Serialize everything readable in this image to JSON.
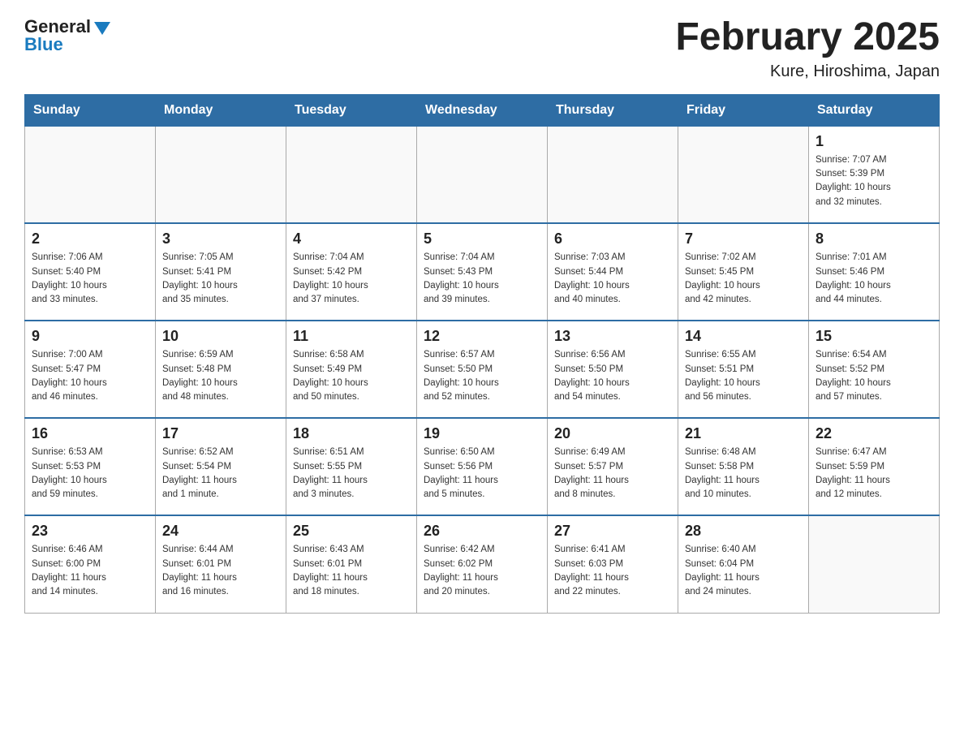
{
  "header": {
    "logo_general": "General",
    "logo_blue": "Blue",
    "title": "February 2025",
    "subtitle": "Kure, Hiroshima, Japan"
  },
  "days_of_week": [
    "Sunday",
    "Monday",
    "Tuesday",
    "Wednesday",
    "Thursday",
    "Friday",
    "Saturday"
  ],
  "weeks": [
    [
      {
        "day": "",
        "info": ""
      },
      {
        "day": "",
        "info": ""
      },
      {
        "day": "",
        "info": ""
      },
      {
        "day": "",
        "info": ""
      },
      {
        "day": "",
        "info": ""
      },
      {
        "day": "",
        "info": ""
      },
      {
        "day": "1",
        "info": "Sunrise: 7:07 AM\nSunset: 5:39 PM\nDaylight: 10 hours\nand 32 minutes."
      }
    ],
    [
      {
        "day": "2",
        "info": "Sunrise: 7:06 AM\nSunset: 5:40 PM\nDaylight: 10 hours\nand 33 minutes."
      },
      {
        "day": "3",
        "info": "Sunrise: 7:05 AM\nSunset: 5:41 PM\nDaylight: 10 hours\nand 35 minutes."
      },
      {
        "day": "4",
        "info": "Sunrise: 7:04 AM\nSunset: 5:42 PM\nDaylight: 10 hours\nand 37 minutes."
      },
      {
        "day": "5",
        "info": "Sunrise: 7:04 AM\nSunset: 5:43 PM\nDaylight: 10 hours\nand 39 minutes."
      },
      {
        "day": "6",
        "info": "Sunrise: 7:03 AM\nSunset: 5:44 PM\nDaylight: 10 hours\nand 40 minutes."
      },
      {
        "day": "7",
        "info": "Sunrise: 7:02 AM\nSunset: 5:45 PM\nDaylight: 10 hours\nand 42 minutes."
      },
      {
        "day": "8",
        "info": "Sunrise: 7:01 AM\nSunset: 5:46 PM\nDaylight: 10 hours\nand 44 minutes."
      }
    ],
    [
      {
        "day": "9",
        "info": "Sunrise: 7:00 AM\nSunset: 5:47 PM\nDaylight: 10 hours\nand 46 minutes."
      },
      {
        "day": "10",
        "info": "Sunrise: 6:59 AM\nSunset: 5:48 PM\nDaylight: 10 hours\nand 48 minutes."
      },
      {
        "day": "11",
        "info": "Sunrise: 6:58 AM\nSunset: 5:49 PM\nDaylight: 10 hours\nand 50 minutes."
      },
      {
        "day": "12",
        "info": "Sunrise: 6:57 AM\nSunset: 5:50 PM\nDaylight: 10 hours\nand 52 minutes."
      },
      {
        "day": "13",
        "info": "Sunrise: 6:56 AM\nSunset: 5:50 PM\nDaylight: 10 hours\nand 54 minutes."
      },
      {
        "day": "14",
        "info": "Sunrise: 6:55 AM\nSunset: 5:51 PM\nDaylight: 10 hours\nand 56 minutes."
      },
      {
        "day": "15",
        "info": "Sunrise: 6:54 AM\nSunset: 5:52 PM\nDaylight: 10 hours\nand 57 minutes."
      }
    ],
    [
      {
        "day": "16",
        "info": "Sunrise: 6:53 AM\nSunset: 5:53 PM\nDaylight: 10 hours\nand 59 minutes."
      },
      {
        "day": "17",
        "info": "Sunrise: 6:52 AM\nSunset: 5:54 PM\nDaylight: 11 hours\nand 1 minute."
      },
      {
        "day": "18",
        "info": "Sunrise: 6:51 AM\nSunset: 5:55 PM\nDaylight: 11 hours\nand 3 minutes."
      },
      {
        "day": "19",
        "info": "Sunrise: 6:50 AM\nSunset: 5:56 PM\nDaylight: 11 hours\nand 5 minutes."
      },
      {
        "day": "20",
        "info": "Sunrise: 6:49 AM\nSunset: 5:57 PM\nDaylight: 11 hours\nand 8 minutes."
      },
      {
        "day": "21",
        "info": "Sunrise: 6:48 AM\nSunset: 5:58 PM\nDaylight: 11 hours\nand 10 minutes."
      },
      {
        "day": "22",
        "info": "Sunrise: 6:47 AM\nSunset: 5:59 PM\nDaylight: 11 hours\nand 12 minutes."
      }
    ],
    [
      {
        "day": "23",
        "info": "Sunrise: 6:46 AM\nSunset: 6:00 PM\nDaylight: 11 hours\nand 14 minutes."
      },
      {
        "day": "24",
        "info": "Sunrise: 6:44 AM\nSunset: 6:01 PM\nDaylight: 11 hours\nand 16 minutes."
      },
      {
        "day": "25",
        "info": "Sunrise: 6:43 AM\nSunset: 6:01 PM\nDaylight: 11 hours\nand 18 minutes."
      },
      {
        "day": "26",
        "info": "Sunrise: 6:42 AM\nSunset: 6:02 PM\nDaylight: 11 hours\nand 20 minutes."
      },
      {
        "day": "27",
        "info": "Sunrise: 6:41 AM\nSunset: 6:03 PM\nDaylight: 11 hours\nand 22 minutes."
      },
      {
        "day": "28",
        "info": "Sunrise: 6:40 AM\nSunset: 6:04 PM\nDaylight: 11 hours\nand 24 minutes."
      },
      {
        "day": "",
        "info": ""
      }
    ]
  ]
}
